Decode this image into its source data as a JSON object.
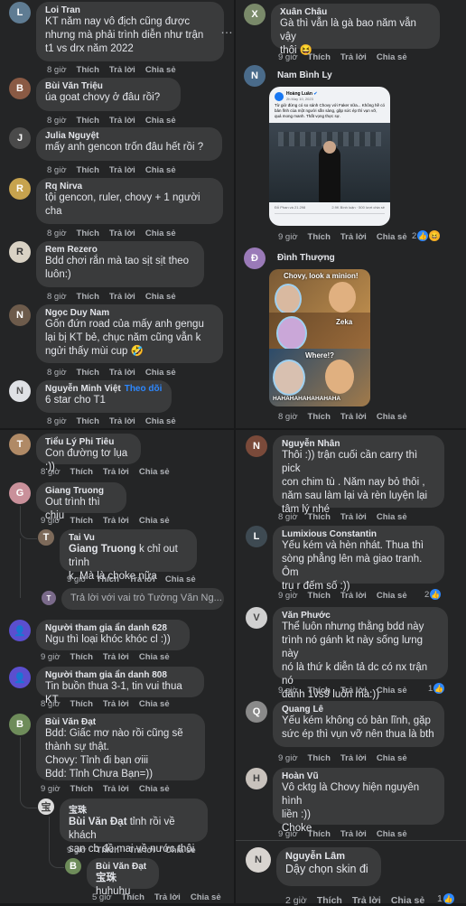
{
  "labels": {
    "like": "Thích",
    "reply": "Trả lời",
    "share": "Chia sẻ",
    "follow": "Theo dõi"
  },
  "panel1": {
    "comments": [
      {
        "name": "Loi Tran",
        "text": "KT năm nay vô địch cũng được\nnhưng mà phải trình diễn như trận\nt1 vs drx năm 2022",
        "time": "8 giờ"
      },
      {
        "name": "Bùi Văn Triệu",
        "text": "úa goat chovy ở đâu rồi?",
        "time": "8 giờ"
      },
      {
        "name": "Julia Nguyệt",
        "text": "mấy anh gencon trốn đâu hết rồi ?",
        "time": "8 giờ"
      },
      {
        "name": "Rq Nirva",
        "text": "tội gencon, ruler, chovy + 1 người\ncha",
        "time": "8 giờ"
      },
      {
        "name": "Rem Rezero",
        "text": "Bdd chơi rắn mà tao sịt sịt theo\nluôn:)",
        "time": "8 giờ"
      },
      {
        "name": "Ngọc Duy Nam",
        "text": "Gốn đứn road của mấy anh gengu\nlại bị KT bẻ, chục năm cũng vẫn k\nngửi thấy mùi cup 🤣",
        "time": "8 giờ"
      },
      {
        "name": "Nguyễn Minh Việt",
        "text": "6 star cho T1",
        "time": "8 giờ"
      }
    ],
    "more": "…"
  },
  "panel2": {
    "c1": {
      "name": "Xuân Châu",
      "text": "Gà thì vẫn là gà bao năm vẫn vậy\nthôi 😆",
      "time": "9 giờ"
    },
    "c2": {
      "name": "Nam Bình Ly",
      "time": "9 giờ",
      "reacts": "2",
      "post": {
        "author": "Hoàng Luân",
        "verified": "✔",
        "date": "2h May 10, 2023",
        "caption": "Từ giờ đừng có so sánh Chovy với Faker nữa... Không hề có bản lĩnh của một người sẵn sàng, gặp sức ép thì vụn vỡ, quá mong manh. Thất vọng thực sự.",
        "stats": "Đỗ Phan và 21.298",
        "comments": "2.9K Bình luận · 500 lượt chia sẻ"
      }
    },
    "c3": {
      "name": "Đình Thượng",
      "time": "8 giờ",
      "meme": {
        "top": "Chovy, look a minion!",
        "mid": "Zeka",
        "where": "Where!?",
        "bottom": "HAHAHAHAHAHAHAHA"
      }
    }
  },
  "panel3": {
    "comments": [
      {
        "name": "Tiểu Lý Phi Tiêu",
        "text": "Con đường tơ lụa :))",
        "time": "8 giờ"
      },
      {
        "name": "Giang Truong",
        "text": "Out trình thì chịu",
        "time": "9 giờ"
      },
      {
        "name": "Tai Vu",
        "mention": "Giang Truong",
        "text": " k chỉ out trình\nk. Mà là choke nữa",
        "time": "9 giờ"
      },
      {
        "name": "Người tham gia ẩn danh 628",
        "text": "Ngu thì loại khóc khóc cl :))",
        "time": "9 giờ"
      },
      {
        "name": "Người tham gia ẩn danh 808",
        "text": "Tin buồn thua 3-1, tin vui thua KT",
        "time": "8 giờ"
      },
      {
        "name": "Bùi Văn Đạt",
        "text": "Bdd: Giấc mơ nào rồi cũng sẽ\nthành sự thật.\nChovy: Tỉnh đi bạn ơiii\nBdd: Tỉnh Chưa Bạn=))",
        "time": "9 giờ"
      },
      {
        "name": "宝珠",
        "mention": "Bùi Văn Đạt",
        "text": " tỉnh rồi về khách\nsạn cb đồ mai về nước thôi",
        "time": "9 giờ"
      },
      {
        "name": "Bùi Văn Đạt",
        "mention": "宝珠",
        "text": " huhuhu",
        "time": "5 giờ"
      }
    ],
    "reply_placeholder": "Trả lời với vai trò Tường Văn Ng..."
  },
  "panel4": {
    "comments": [
      {
        "name": "Nguyễn Nhân",
        "text": "Thôi :)) trận cuối cần carry thì pick\ncon chim tù . Năm nay bỏ thôi ,\nnăm sau làm lại và rèn luyện lại\ntâm lý nhé",
        "time": "8 giờ"
      },
      {
        "name": "Lumixious Constantin",
        "text": "Yếu kém và hèn nhát. Thua thì\nsòng phẳng lên mà giao tranh. Ôm\ntrụ r đếm số :))",
        "time": "9 giờ",
        "reacts": "2"
      },
      {
        "name": "Văn Phước",
        "text": "Thể luôn nhưng thằng bdd này\ntrình nó gánh kt này sống lưng này\nnó là thứ k diễn tả dc có nx trận nó\nđánh 1vs9 luôn mà:))",
        "time": "9 giờ",
        "reacts": "1"
      },
      {
        "name": "Quang Lê",
        "text": "Yếu kém không có bản lĩnh, gặp\nsức ép thì vụn vỡ nên thua là bth",
        "time": "9 giờ"
      },
      {
        "name": "Hoàn Vũ",
        "text": "Vô cktg là Chovy hiện nguyên hình\nliền :))\nChoke",
        "time": "9 giờ"
      },
      {
        "name": "Nguyễn Lâm",
        "text": "Dậy chọn skin đi",
        "time": "2 giờ",
        "reacts": "1"
      }
    ]
  }
}
